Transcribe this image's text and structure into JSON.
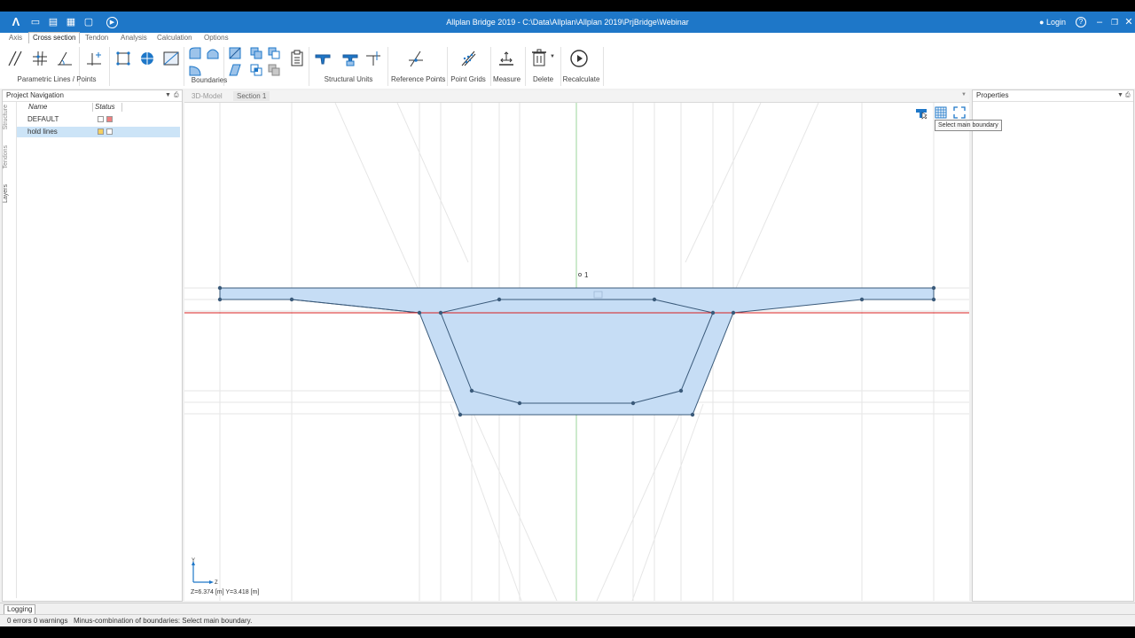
{
  "app": {
    "title": "Allplan Bridge 2019 - C:\\Data\\Allplan\\Allplan 2019\\PrjBridge\\Webinar",
    "login_label": "Login",
    "help_label": "?",
    "brand_color": "#1e77c8"
  },
  "menu": {
    "tabs": [
      {
        "label": "Axis"
      },
      {
        "label": "Cross section"
      },
      {
        "label": "Tendon"
      },
      {
        "label": "Analysis"
      },
      {
        "label": "Calculation"
      },
      {
        "label": "Options"
      }
    ],
    "active": "Cross section"
  },
  "ribbon": {
    "groups": {
      "parametric": "Parametric Lines / Points",
      "boundaries": "Boundaries",
      "structural_units": "Structural Units",
      "reference_points": "Reference Points",
      "point_grids": "Point Grids",
      "measure": "Measure",
      "delete": "Delete",
      "recalculate": "Recalculate"
    }
  },
  "project_navigation": {
    "title": "Project Navigation",
    "side_tabs": [
      "Structure",
      "Tendons",
      "Layers"
    ],
    "columns": [
      "Name",
      "Status"
    ],
    "rows": [
      {
        "name": "DEFAULT",
        "status_colors": [
          "#ffffff",
          "#f08080"
        ]
      },
      {
        "name": "hold lines",
        "status_colors": [
          "#f5d060",
          "#ffffff"
        ]
      }
    ]
  },
  "properties": {
    "title": "Properties"
  },
  "view_tabs": [
    "3D-Model",
    "Section 1"
  ],
  "active_view": "Section 1",
  "viewport": {
    "point_label": "1",
    "tooltip": "Select main boundary",
    "axis_y": "Y",
    "axis_z": "Z",
    "coord_readout": "Z=6.374 [m] Y=3.418 [m]",
    "fill_color": "#c6ddf5",
    "outline_color": "#3a5a7a"
  },
  "logging": {
    "tab_label": "Logging"
  },
  "status": {
    "errors": "0 errors 0 warnings",
    "message": "Minus-combination of boundaries: Select main boundary."
  }
}
